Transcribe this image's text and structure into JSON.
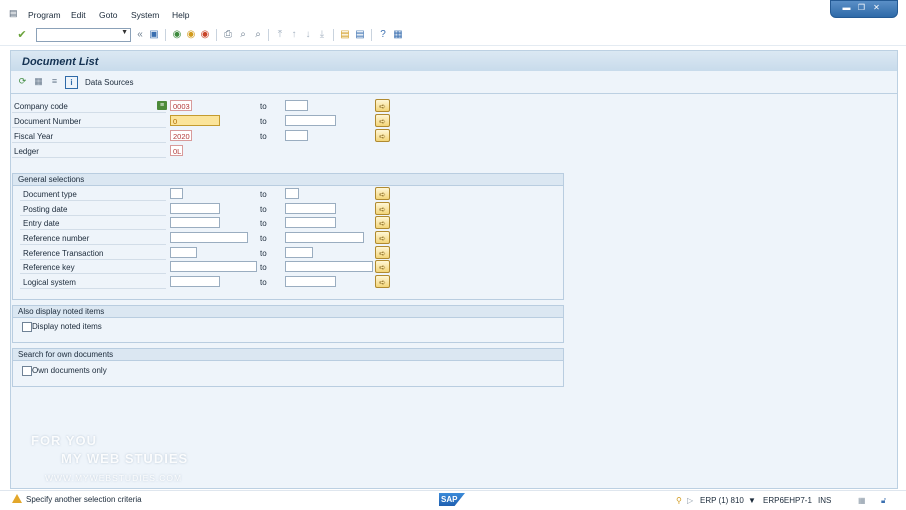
{
  "menubar": {
    "items": [
      {
        "label": "Program"
      },
      {
        "label": "Edit"
      },
      {
        "label": "Goto"
      },
      {
        "label": "System"
      },
      {
        "label": "Help"
      }
    ]
  },
  "toolbar": {
    "command_field_value": ""
  },
  "page": {
    "title": "Document List",
    "app_toolbar": {
      "data_sources_label": "Data Sources"
    }
  },
  "top_fields": [
    {
      "label": "Company code",
      "low": "0003",
      "to_label": "to",
      "high": ""
    },
    {
      "label": "Document Number",
      "low": "0",
      "to_label": "to",
      "high": ""
    },
    {
      "label": "Fiscal Year",
      "low": "2020",
      "to_label": "to",
      "high": ""
    },
    {
      "label": "Ledger",
      "low": "0L"
    }
  ],
  "general_selections": {
    "title": "General selections",
    "rows": [
      {
        "label": "Document type",
        "low": "",
        "to_label": "to",
        "high": ""
      },
      {
        "label": "Posting date",
        "low": "",
        "to_label": "to",
        "high": ""
      },
      {
        "label": "Entry date",
        "low": "",
        "to_label": "to",
        "high": ""
      },
      {
        "label": "Reference number",
        "low": "",
        "to_label": "to",
        "high": ""
      },
      {
        "label": "Reference Transaction",
        "low": "",
        "to_label": "to",
        "high": ""
      },
      {
        "label": "Reference key",
        "low": "",
        "to_label": "to",
        "high": ""
      },
      {
        "label": "Logical system",
        "low": "",
        "to_label": "to",
        "high": ""
      }
    ]
  },
  "noted_items": {
    "title": "Also display noted items",
    "checkbox_label": "Display noted items",
    "checked": false
  },
  "own_documents": {
    "title": "Search for own documents",
    "checkbox_label": "Own documents only",
    "checked": false
  },
  "watermark": {
    "line1": "FOR YOU",
    "line2": "MY WEB STUDIES",
    "line3": "WWW.MYWEBSTUDIES.COM"
  },
  "statusbar": {
    "message": "Specify another selection criteria",
    "logo_text": "SAP",
    "system": "ERP (1) 810",
    "server": "ERP6EHP7-1",
    "mode": "INS"
  },
  "colors": {
    "title_band": "#c8dbeb",
    "work_area": "#eef4fa",
    "active_field": "#fbe49a",
    "multisel_button": "#f3d57a",
    "warning": "#e3a72a"
  },
  "icons": [
    "sap-menu-icon",
    "check-icon",
    "back-icon",
    "save-icon",
    "exit-icon",
    "cancel-icon",
    "print-icon",
    "find-icon",
    "help-icon",
    "customize-icon",
    "execute-icon",
    "info-icon",
    "multiple-selection-icon",
    "warning-icon"
  ]
}
